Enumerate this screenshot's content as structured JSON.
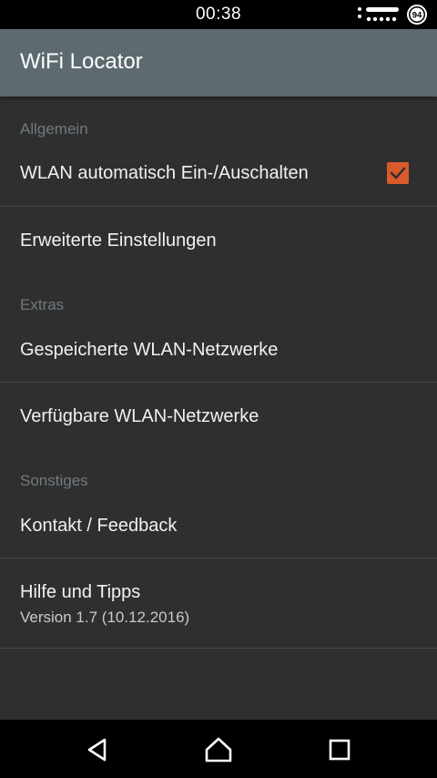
{
  "status_bar": {
    "time": "00:38",
    "battery_level": "94",
    "signal_icon": "signal-dots-icon"
  },
  "app_bar": {
    "title": "WiFi Locator"
  },
  "preferences": {
    "general": {
      "header": "Allgemein",
      "auto_wifi": {
        "label": "WLAN automatisch Ein-/Auschalten",
        "checked": true
      },
      "advanced": {
        "label": "Erweiterte Einstellungen"
      }
    },
    "extras": {
      "header": "Extras",
      "saved_networks": {
        "label": "Gespeicherte WLAN-Netzwerke"
      },
      "available_networks": {
        "label": "Verfügbare WLAN-Netzwerke"
      }
    },
    "misc": {
      "header": "Sonstiges",
      "contact": {
        "label": "Kontakt / Feedback"
      },
      "help": {
        "label": "Hilfe und Tipps",
        "summary": "Version 1.7 (10.12.2016)"
      }
    }
  },
  "nav_bar": {
    "back_icon": "back-triangle-icon",
    "home_icon": "home-icon",
    "recents_icon": "recents-square-icon"
  },
  "colors": {
    "background": "#2f2f2f",
    "app_bar": "#5d6a70",
    "accent": "#d95a2a",
    "section_header": "#6f7a80",
    "divider": "#464646"
  }
}
